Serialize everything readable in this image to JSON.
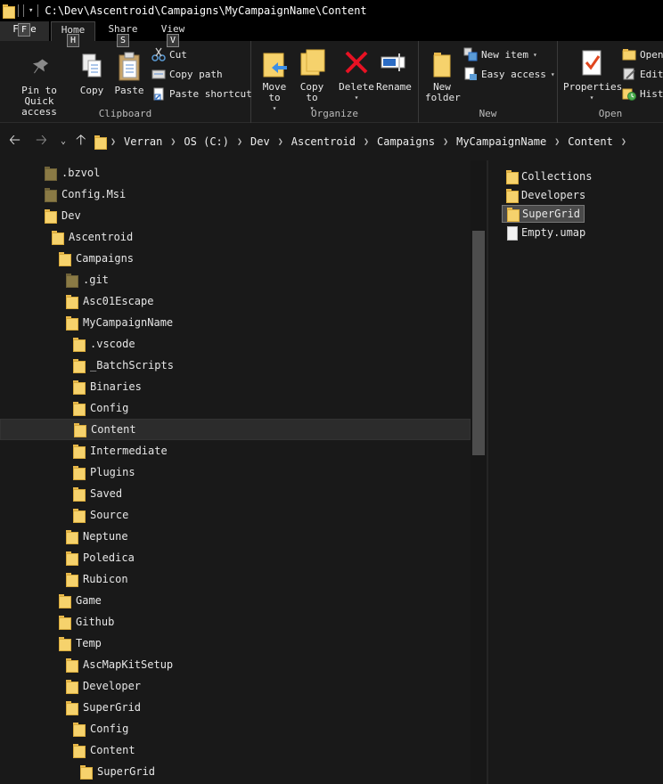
{
  "window": {
    "title": "C:\\Dev\\Ascentroid\\Campaigns\\MyCampaignName\\Content"
  },
  "tabs": {
    "file": "File",
    "home": "Home",
    "share": "Share",
    "view": "View",
    "keytips": {
      "file": "F",
      "home": "H",
      "share": "S",
      "view": "V"
    }
  },
  "ribbon": {
    "clipboard": {
      "label": "Clipboard",
      "pin": "Pin to Quick access",
      "copy": "Copy",
      "paste": "Paste",
      "cut": "Cut",
      "copy_path": "Copy path",
      "paste_shortcut": "Paste shortcut"
    },
    "organize": {
      "label": "Organize",
      "move_to": "Move to",
      "copy_to": "Copy to",
      "delete": "Delete",
      "rename": "Rename"
    },
    "new": {
      "label": "New",
      "new_folder": "New folder",
      "new_item": "New item",
      "easy_access": "Easy access"
    },
    "open": {
      "label": "Open",
      "properties": "Properties",
      "open": "Open",
      "edit": "Edit",
      "history": "Hist"
    }
  },
  "breadcrumbs": [
    "Verran",
    "OS (C:)",
    "Dev",
    "Ascentroid",
    "Campaigns",
    "MyCampaignName",
    "Content"
  ],
  "tree": [
    {
      "label": ".bzvol",
      "depth": 0,
      "dim": true
    },
    {
      "label": "Config.Msi",
      "depth": 0,
      "dim": true
    },
    {
      "label": "Dev",
      "depth": 0
    },
    {
      "label": "Ascentroid",
      "depth": 1
    },
    {
      "label": "Campaigns",
      "depth": 2
    },
    {
      "label": ".git",
      "depth": 3,
      "dim": true
    },
    {
      "label": "Asc01Escape",
      "depth": 3
    },
    {
      "label": "MyCampaignName",
      "depth": 3
    },
    {
      "label": ".vscode",
      "depth": 4
    },
    {
      "label": "_BatchScripts",
      "depth": 4
    },
    {
      "label": "Binaries",
      "depth": 4
    },
    {
      "label": "Config",
      "depth": 4
    },
    {
      "label": "Content",
      "depth": 4,
      "selected": true
    },
    {
      "label": "Intermediate",
      "depth": 4
    },
    {
      "label": "Plugins",
      "depth": 4
    },
    {
      "label": "Saved",
      "depth": 4
    },
    {
      "label": "Source",
      "depth": 4
    },
    {
      "label": "Neptune",
      "depth": 3
    },
    {
      "label": "Poledica",
      "depth": 3
    },
    {
      "label": "Rubicon",
      "depth": 3
    },
    {
      "label": "Game",
      "depth": 2
    },
    {
      "label": "Github",
      "depth": 2
    },
    {
      "label": "Temp",
      "depth": 2
    },
    {
      "label": "AscMapKitSetup",
      "depth": 3
    },
    {
      "label": "Developer",
      "depth": 3
    },
    {
      "label": "SuperGrid",
      "depth": 3
    },
    {
      "label": "Config",
      "depth": 4
    },
    {
      "label": "Content",
      "depth": 4
    },
    {
      "label": "SuperGrid",
      "depth": 5
    }
  ],
  "files": [
    {
      "label": "Collections",
      "kind": "folder"
    },
    {
      "label": "Developers",
      "kind": "folder"
    },
    {
      "label": "SuperGrid",
      "kind": "folder",
      "selected": true
    },
    {
      "label": "Empty.umap",
      "kind": "file"
    }
  ]
}
